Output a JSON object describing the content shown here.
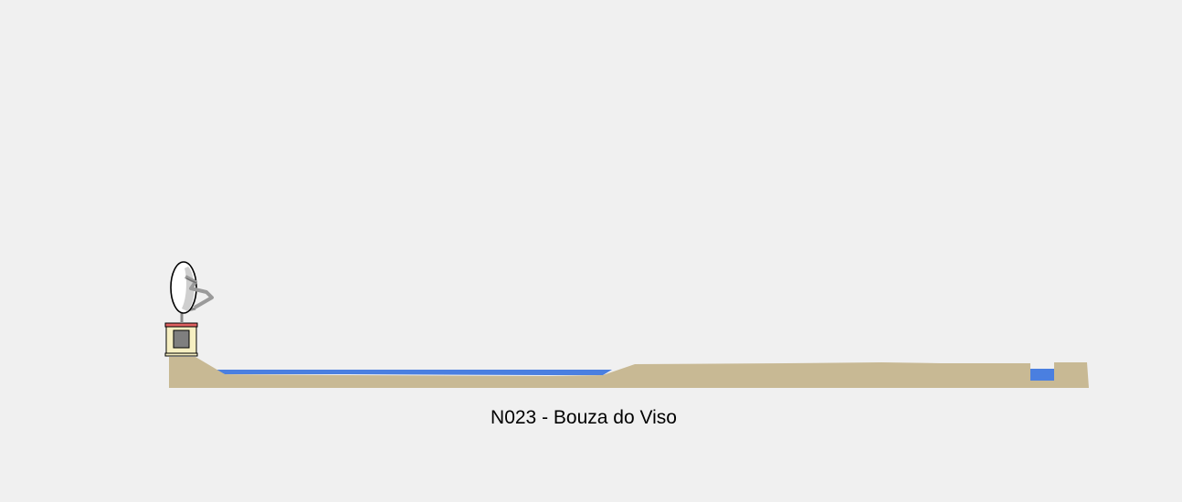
{
  "profile": {
    "caption": "N023 - Bouza do Viso",
    "icons": {
      "antenna": "satellite-dish-icon",
      "station": "station-tower-icon"
    },
    "colors": {
      "background": "#f0f0f0",
      "terrain": "#c8b994",
      "water": "#4a7fe0",
      "dish": "#d8d8d8",
      "station_body": "#f6efc2",
      "station_core": "#7f7f7f",
      "station_roof": "#e06060"
    }
  }
}
